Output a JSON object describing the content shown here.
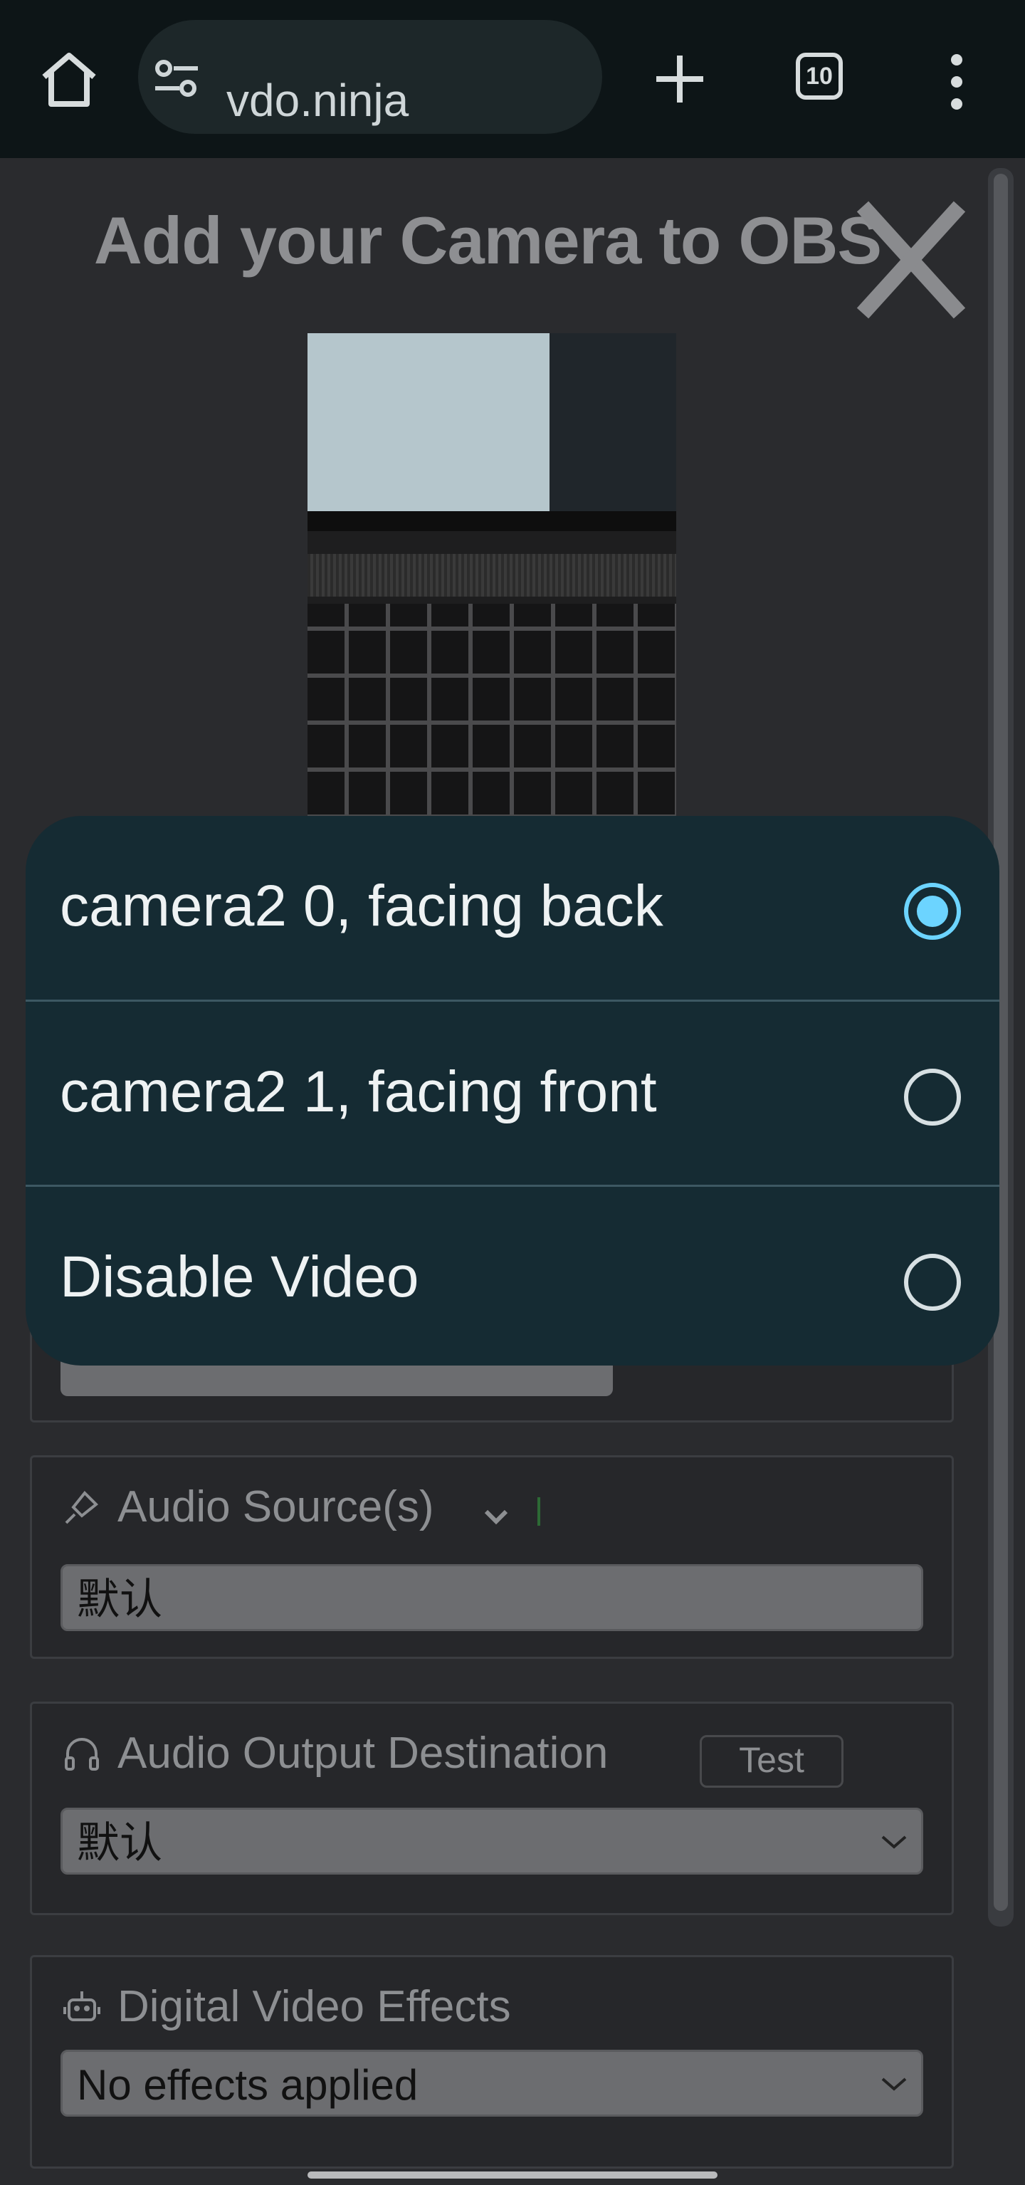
{
  "browser": {
    "url": "vdo.ninja",
    "tab_count": "10"
  },
  "page": {
    "title": "Add your Camera to OBS"
  },
  "video_chooser": {
    "options": [
      {
        "label": "camera2 0, facing back",
        "selected": true
      },
      {
        "label": "camera2 1, facing front",
        "selected": false
      },
      {
        "label": "Disable Video",
        "selected": false
      }
    ]
  },
  "audio_source": {
    "label": "Audio Source(s)",
    "value": "默认"
  },
  "audio_output": {
    "label": "Audio Output Destination",
    "test_label": "Test",
    "value": "默认"
  },
  "video_effects": {
    "label": "Digital Video Effects",
    "value": "No effects applied"
  },
  "colors": {
    "accent": "#6cd4ff",
    "chooser_bg": "#152b33",
    "topbar_bg": "#0d1517"
  }
}
